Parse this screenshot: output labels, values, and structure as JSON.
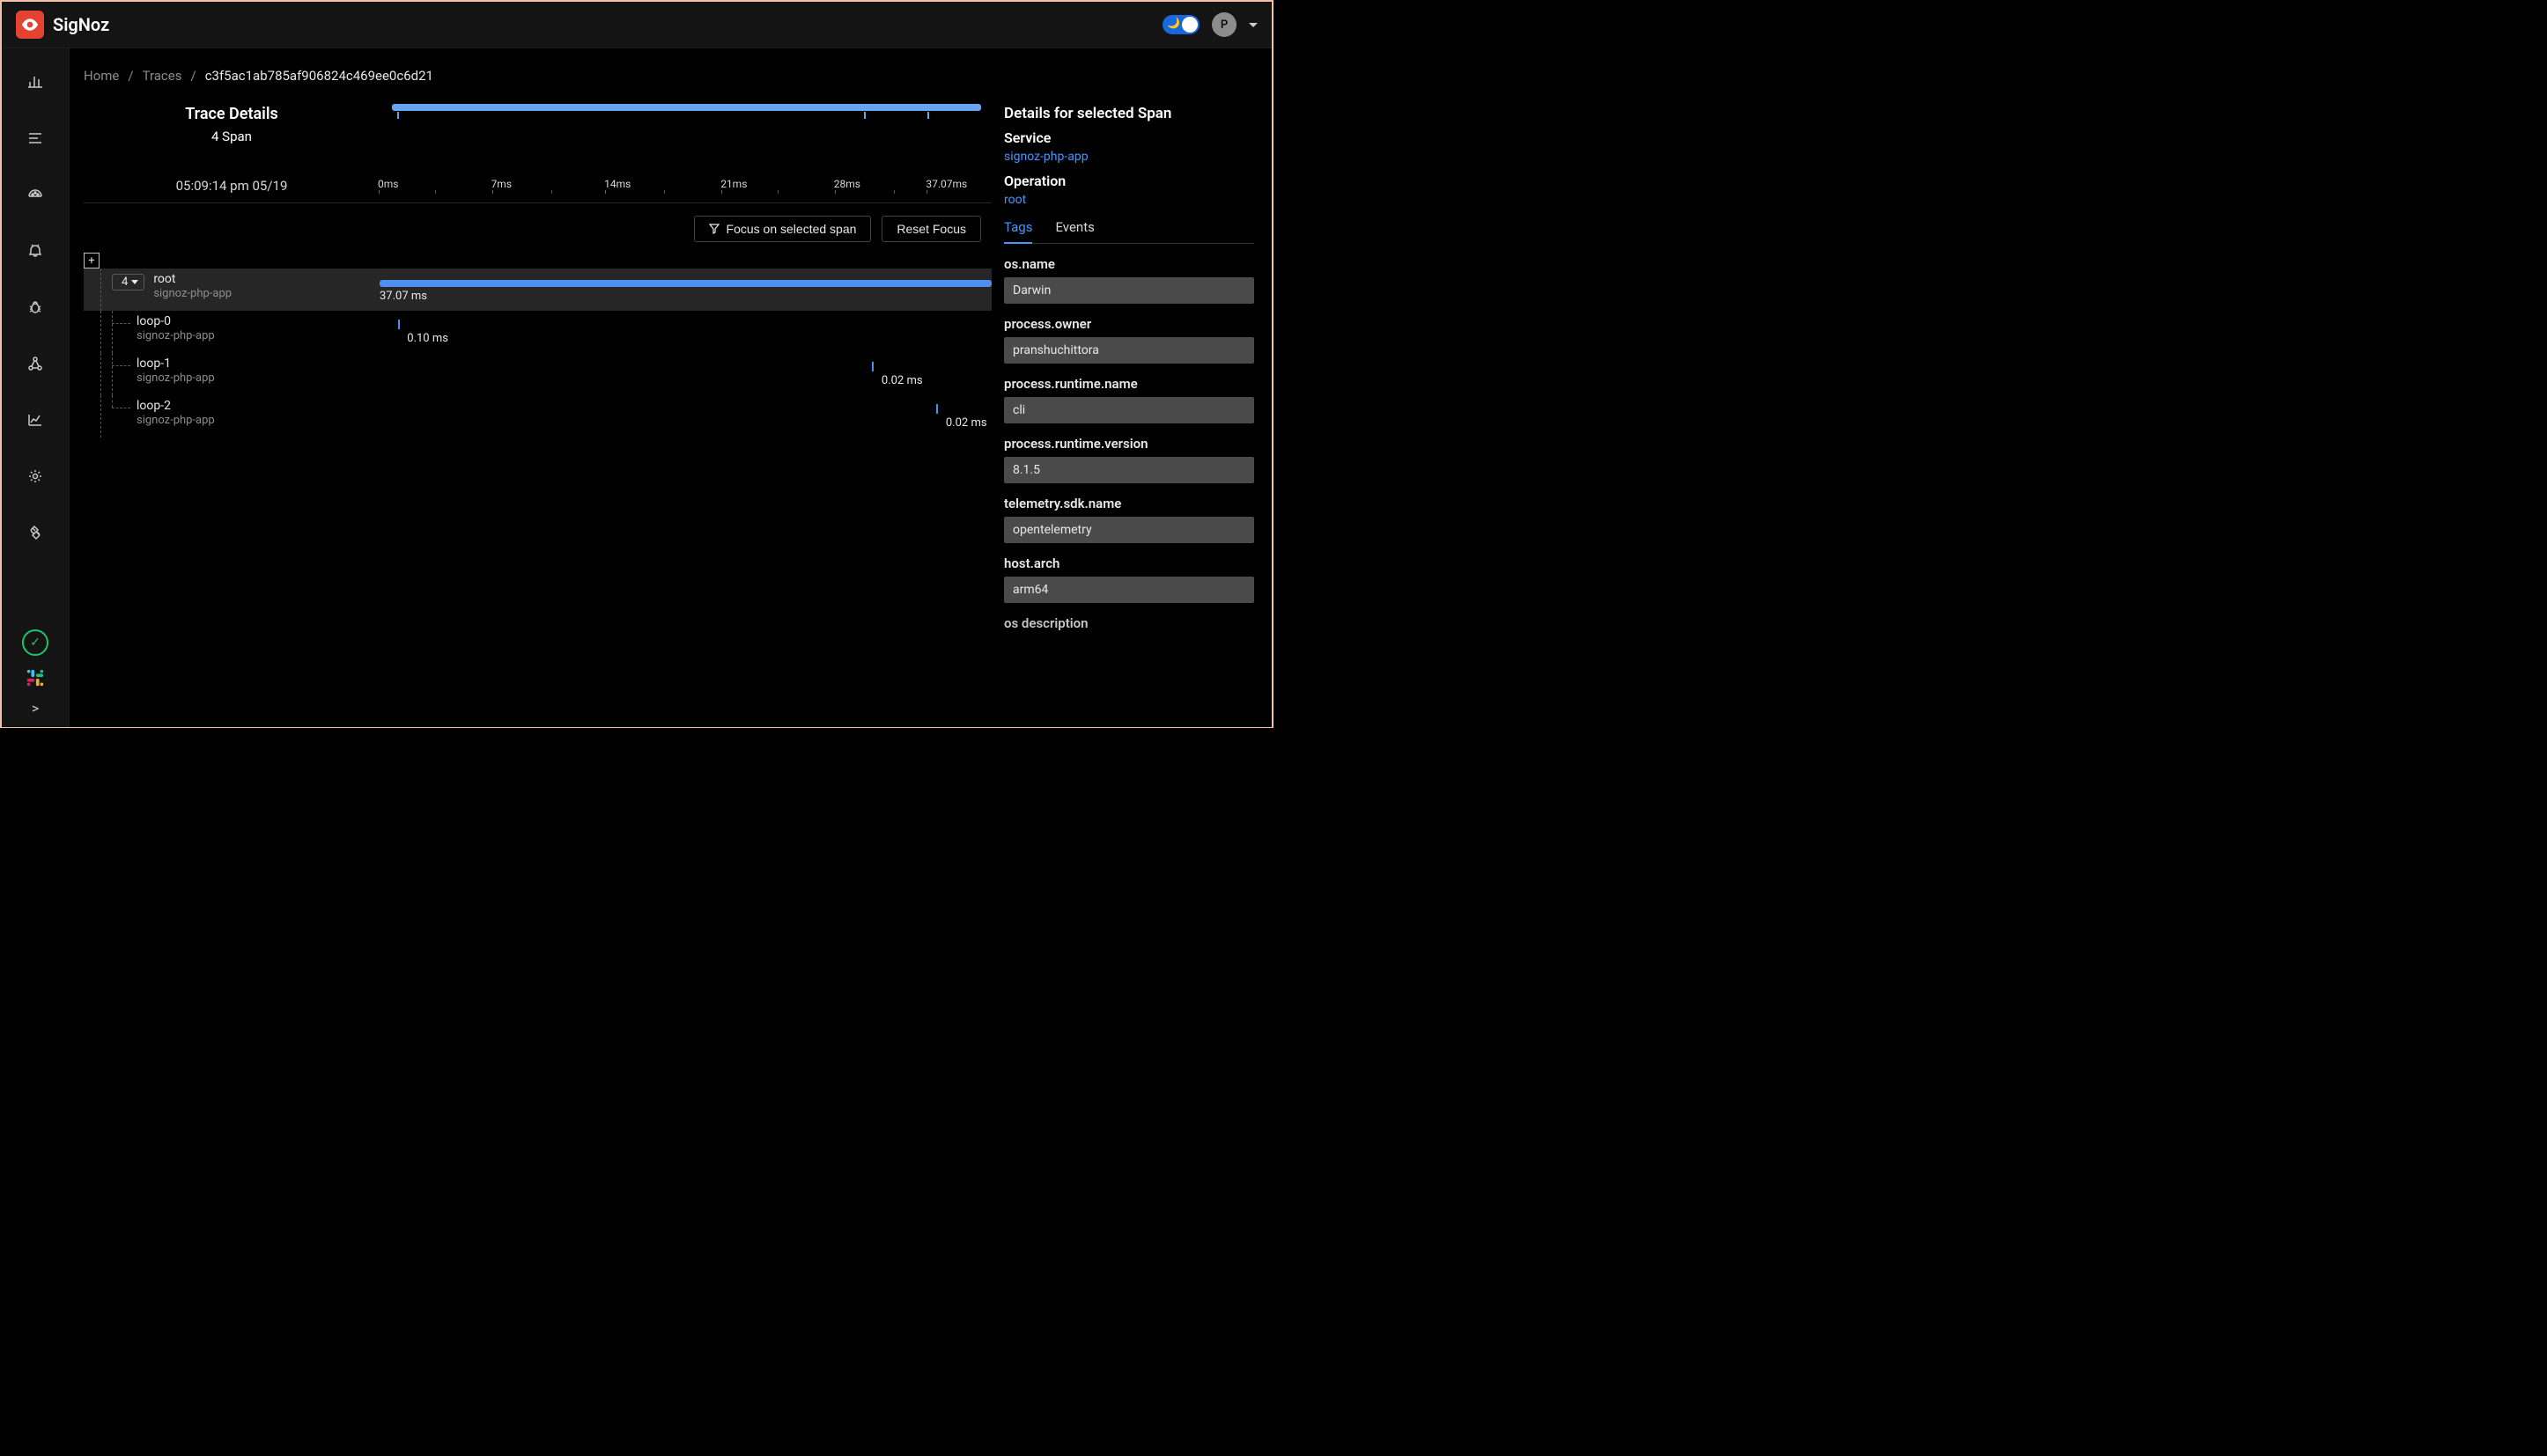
{
  "brand": "SigNoz",
  "user_initial": "P",
  "breadcrumb": {
    "home": "Home",
    "traces": "Traces",
    "trace_id": "c3f5ac1ab785af906824c469ee0c6d21"
  },
  "trace": {
    "title": "Trace Details",
    "span_count_label": "4 Span",
    "timestamp": "05:09:14 pm 05/19",
    "axis_ticks": [
      "0ms",
      "7ms",
      "14ms",
      "21ms",
      "28ms",
      "37.07ms"
    ]
  },
  "buttons": {
    "focus": "Focus on selected span",
    "reset": "Reset Focus"
  },
  "waterfall": {
    "root_count": "4",
    "spans": [
      {
        "name": "root",
        "service": "signoz-php-app",
        "duration": "37.07 ms"
      },
      {
        "name": "loop-0",
        "service": "signoz-php-app",
        "duration": "0.10 ms"
      },
      {
        "name": "loop-1",
        "service": "signoz-php-app",
        "duration": "0.02 ms"
      },
      {
        "name": "loop-2",
        "service": "signoz-php-app",
        "duration": "0.02 ms"
      }
    ]
  },
  "details": {
    "title": "Details for selected Span",
    "service_label": "Service",
    "service": "signoz-php-app",
    "operation_label": "Operation",
    "operation": "root",
    "tabs": {
      "tags": "Tags",
      "events": "Events"
    },
    "tags": [
      {
        "key": "os.name",
        "value": "Darwin"
      },
      {
        "key": "process.owner",
        "value": "pranshuchittora"
      },
      {
        "key": "process.runtime.name",
        "value": "cli"
      },
      {
        "key": "process.runtime.version",
        "value": "8.1.5"
      },
      {
        "key": "telemetry.sdk.name",
        "value": "opentelemetry"
      },
      {
        "key": "host.arch",
        "value": "arm64"
      }
    ],
    "partial_key": "os description"
  }
}
